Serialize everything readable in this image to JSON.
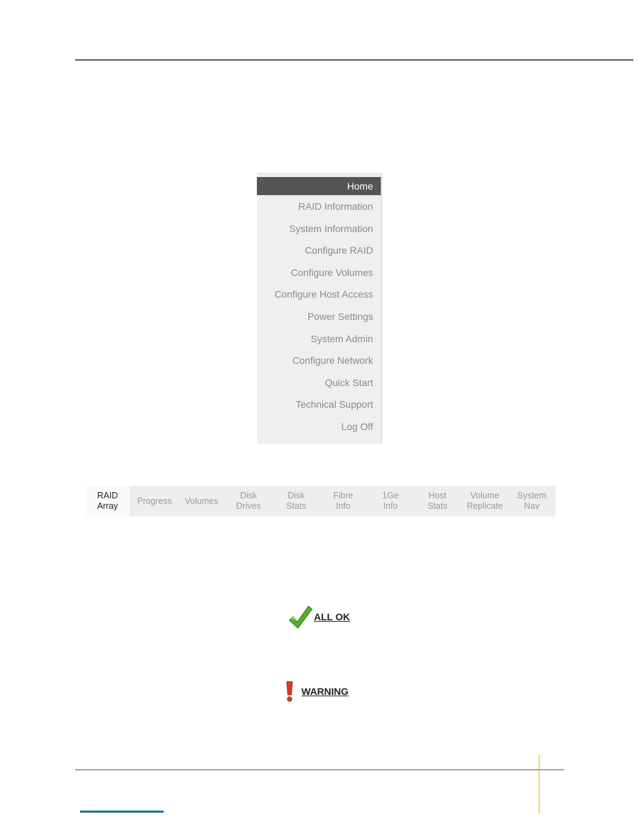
{
  "menu": {
    "items": [
      {
        "label": "Home",
        "active": true
      },
      {
        "label": "RAID Information"
      },
      {
        "label": "System Information"
      },
      {
        "label": "Configure RAID"
      },
      {
        "label": "Configure Volumes"
      },
      {
        "label": "Configure Host Access"
      },
      {
        "label": "Power Settings"
      },
      {
        "label": "System Admin"
      },
      {
        "label": "Configure Network"
      },
      {
        "label": "Quick Start"
      },
      {
        "label": "Technical Support"
      },
      {
        "label": "Log Off"
      }
    ]
  },
  "tabs": [
    {
      "line1": "RAID",
      "line2": "Array",
      "active": true
    },
    {
      "line1": "Progress",
      "line2": ""
    },
    {
      "line1": "Volumes",
      "line2": ""
    },
    {
      "line1": "Disk",
      "line2": "Drives"
    },
    {
      "line1": "Disk",
      "line2": "Stats"
    },
    {
      "line1": "Fibre",
      "line2": "Info"
    },
    {
      "line1": "1Ge",
      "line2": "Info"
    },
    {
      "line1": "Host",
      "line2": "Stats"
    },
    {
      "line1": "Volume",
      "line2": "Replicate"
    },
    {
      "line1": "System",
      "line2": "Nav"
    }
  ],
  "status": {
    "ok": {
      "label": "ALL OK",
      "icon": "checkmark-icon",
      "color": "#5bb030"
    },
    "warning": {
      "label": "WARNING",
      "icon": "exclamation-icon",
      "color": "#d83a30"
    }
  },
  "colors": {
    "menu_active_bg": "#555555",
    "footer_blue": "#1a6e9a",
    "footer_gold": "#e8b400"
  }
}
